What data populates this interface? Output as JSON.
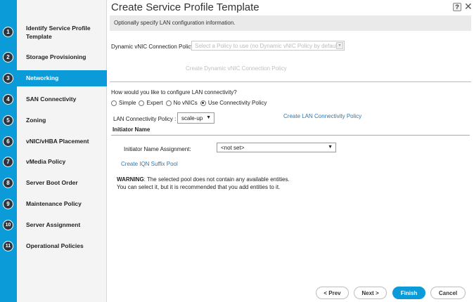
{
  "window": {
    "title": "Create Service Profile Template",
    "help": "?",
    "close": "✕"
  },
  "steps": [
    {
      "n": "1",
      "label": "Identify Service Profile Template"
    },
    {
      "n": "2",
      "label": "Storage Provisioning"
    },
    {
      "n": "3",
      "label": "Networking"
    },
    {
      "n": "4",
      "label": "SAN Connectivity"
    },
    {
      "n": "5",
      "label": "Zoning"
    },
    {
      "n": "6",
      "label": "vNIC/vHBA Placement"
    },
    {
      "n": "7",
      "label": "vMedia Policy"
    },
    {
      "n": "8",
      "label": "Server Boot Order"
    },
    {
      "n": "9",
      "label": "Maintenance Policy"
    },
    {
      "n": "10",
      "label": "Server Assignment"
    },
    {
      "n": "11",
      "label": "Operational Policies"
    }
  ],
  "banner": "Optionally specify LAN configuration information.",
  "dynamic_vnic": {
    "label": "Dynamic vNIC Connection Policy:",
    "placeholder": "Select a Policy to use (no Dynamic vNIC Policy by default)",
    "create_link": "Create Dynamic vNIC Connection Policy"
  },
  "lan_question": "How would you like to configure LAN connectivity?",
  "lan_options": [
    "Simple",
    "Expert",
    "No vNICs",
    "Use Connectivity Policy"
  ],
  "lan_selected": "Use Connectivity Policy",
  "lan_policy": {
    "label": "LAN Connectivity Policy :",
    "value": "scale-up",
    "create_link": "Create LAN Connectivity Policy"
  },
  "initiator": {
    "section": "Initiator Name",
    "label": "Initiator Name Assignment:",
    "value": "<not set>",
    "create_link": "Create IQN Suffix Pool"
  },
  "warning": {
    "bold": "WARNING",
    "line1": ": The selected pool does not contain any available entities.",
    "line2": "You can select it, but it is recommended that you add entities to it."
  },
  "buttons": {
    "prev": "< Prev",
    "next": "Next >",
    "finish": "Finish",
    "cancel": "Cancel"
  },
  "colors": {
    "accent": "#0b9bd8",
    "link": "#2a77b5"
  }
}
